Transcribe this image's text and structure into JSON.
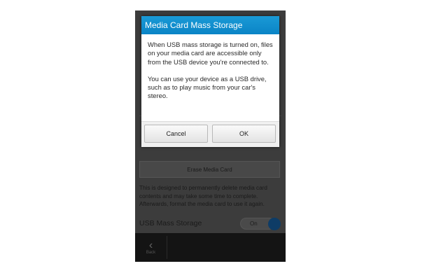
{
  "dialog": {
    "title": "Media Card Mass Storage",
    "paragraph_1": "When USB mass storage is turned on, files on your media card are accessible only from the USB device you're connected to.",
    "paragraph_2": "You can use your device as a USB drive, such as to play music from your car's stereo.",
    "cancel_label": "Cancel",
    "ok_label": "OK",
    "accent_color": "#1a9ad6"
  },
  "background_screen": {
    "erase_button_label": "Erase Media Card",
    "erase_description": "This is designed to permanently delete media card contents and may take some time to complete. Afterwards, format the media card to use it again.",
    "usb_mass_storage_label": "USB Mass Storage",
    "usb_toggle_state": "On",
    "back_label": "Back",
    "back_icon": "chevron-left-icon"
  }
}
